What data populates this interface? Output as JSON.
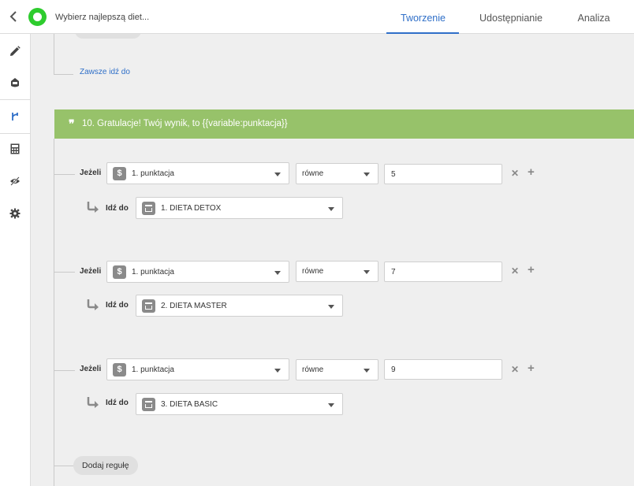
{
  "header": {
    "title": "Wybierz najlepszą diet...",
    "tabs": [
      {
        "label": "Tworzenie",
        "active": true
      },
      {
        "label": "Udostępnianie",
        "active": false
      },
      {
        "label": "Analiza",
        "active": false
      }
    ]
  },
  "sidebar": {
    "items": [
      {
        "icon": "pencil-icon"
      },
      {
        "icon": "paint-bucket-icon"
      },
      {
        "icon": "branch-icon",
        "active": true
      },
      {
        "icon": "calculator-icon"
      },
      {
        "icon": "eye-slash-icon"
      },
      {
        "icon": "gear-icon"
      }
    ]
  },
  "always_goto_label": "Zawsze idź do",
  "question": {
    "text": "10. Gratulacje! Twój wynik, to {{variable:punktacja}}"
  },
  "rules": [
    {
      "if_label": "Jeżeli",
      "variable": "1. punktacja",
      "operator": "równe",
      "value": "5",
      "goto_label": "Idź do",
      "target": "1. DIETA DETOX"
    },
    {
      "if_label": "Jeżeli",
      "variable": "1. punktacja",
      "operator": "równe",
      "value": "7",
      "goto_label": "Idź do",
      "target": "2. DIETA MASTER"
    },
    {
      "if_label": "Jeżeli",
      "variable": "1. punktacja",
      "operator": "równe",
      "value": "9",
      "goto_label": "Idź do",
      "target": "3. DIETA BASIC"
    }
  ],
  "add_rule_label": "Dodaj regułę",
  "colors": {
    "accent": "#2f6fc8",
    "question_header": "#97c26a",
    "logo": "#2ecc2e"
  }
}
